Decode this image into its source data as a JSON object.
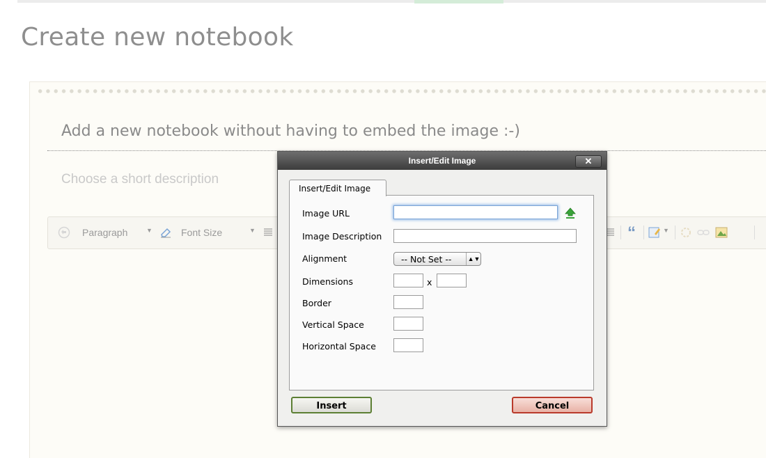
{
  "page": {
    "title": "Create new notebook",
    "notebook_title": "Add a new notebook without having to embed the image :-)",
    "description_placeholder": "Choose a short description"
  },
  "toolbar": {
    "format_select": "Paragraph",
    "font_size_select": "Font Size",
    "quote_glyph": "“"
  },
  "dialog": {
    "title": "Insert/Edit Image",
    "close_label": "✕",
    "tab_label": "Insert/Edit Image",
    "fields": {
      "image_url_label": "Image URL",
      "image_url_value": "",
      "image_description_label": "Image Description",
      "image_description_value": "",
      "alignment_label": "Alignment",
      "alignment_selected": "-- Not Set --",
      "dimensions_label": "Dimensions",
      "dimensions_separator": "x",
      "border_label": "Border",
      "vertical_space_label": "Vertical Space",
      "horizontal_space_label": "Horizontal Space"
    },
    "insert_label": "Insert",
    "cancel_label": "Cancel"
  },
  "colors": {
    "insert_border": "#5c7f33",
    "cancel_border": "#b93a2b",
    "upload_icon": "#3aa33a",
    "focus_ring": "#8ab4e6"
  },
  "icons": [
    "undo-icon",
    "eraser-icon",
    "justify-icon",
    "blockquote-icon",
    "image-edit-icon",
    "unlink-icon",
    "link-icon",
    "insert-image-icon",
    "upload-icon",
    "close-icon",
    "select-arrows-icon"
  ]
}
